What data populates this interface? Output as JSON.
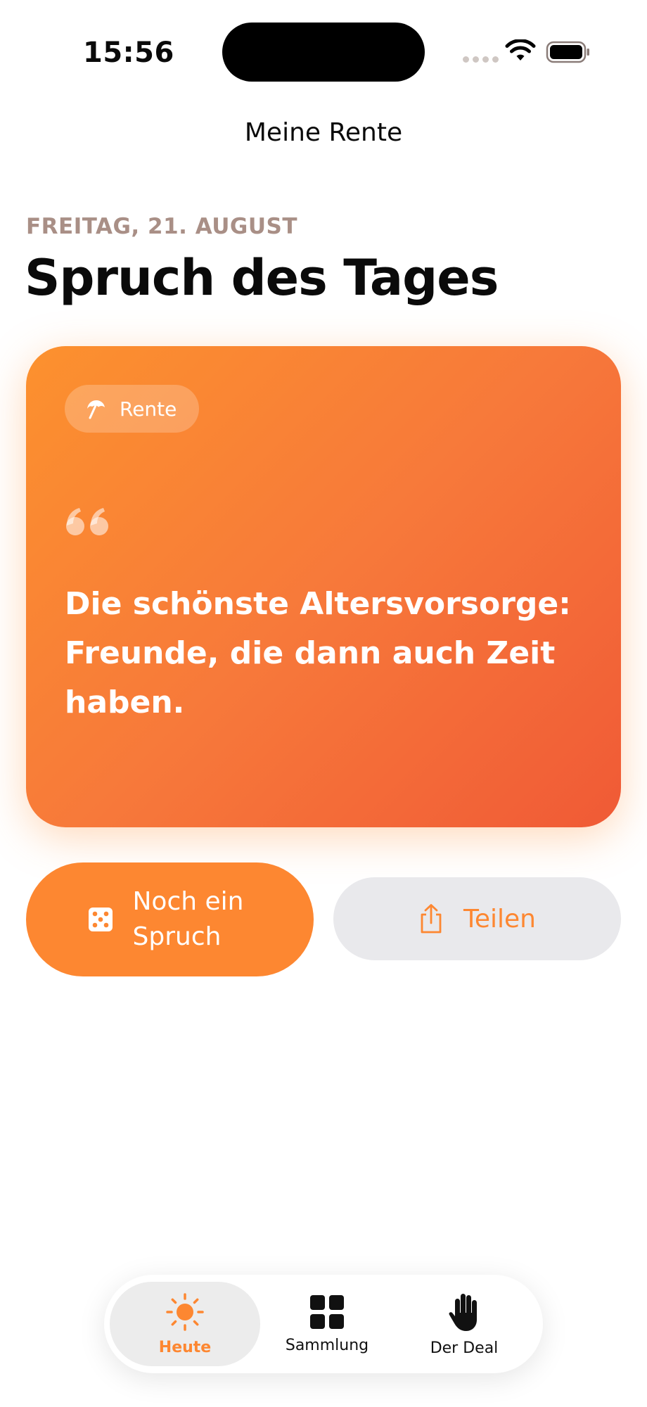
{
  "status_bar": {
    "time": "15:56"
  },
  "nav": {
    "title": "Meine Rente"
  },
  "header": {
    "date": "FREITAG, 21. AUGUST",
    "title": "Spruch des Tages"
  },
  "quote_card": {
    "category_icon": "umbrella-icon",
    "category": "Rente",
    "quote_icon": "quote-mark-icon",
    "text": "Die schönste Altersvorsorge: Freunde, die dann auch Zeit haben.",
    "gradient": [
      "#fc912e",
      "#f05a36"
    ]
  },
  "actions": {
    "another": {
      "icon": "dice-icon",
      "label": "Noch ein Spruch"
    },
    "share": {
      "icon": "share-icon",
      "label": "Teilen"
    }
  },
  "tab_bar": {
    "items": [
      {
        "icon": "sun-icon",
        "label": "Heute",
        "active": true
      },
      {
        "icon": "grid-icon",
        "label": "Sammlung",
        "active": false
      },
      {
        "icon": "hand-icon",
        "label": "Der Deal",
        "active": false
      }
    ]
  },
  "colors": {
    "accent": "#fd8731",
    "date_label": "#a98f86",
    "secondary_button": "#e9e9ec"
  }
}
